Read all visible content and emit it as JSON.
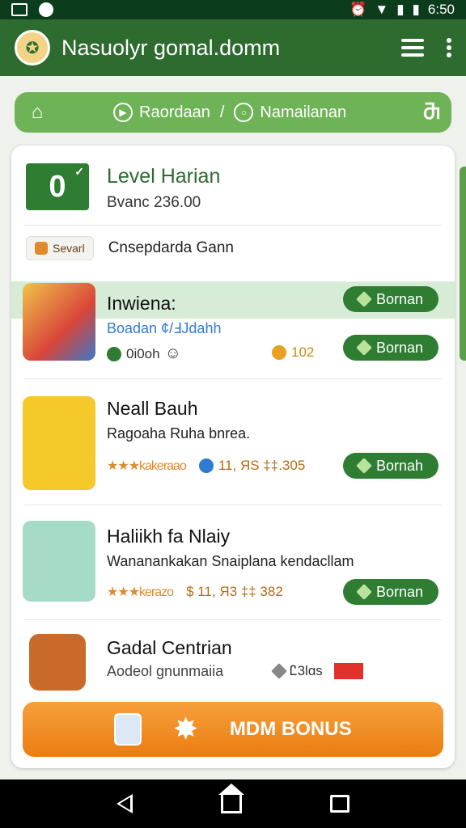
{
  "status_bar": {
    "time": "6:50"
  },
  "app_bar": {
    "title": "Nasuolyr gomal.domm"
  },
  "breadcrumb": {
    "item1": "Raordaan",
    "separator": "/",
    "item2": "Namailanan"
  },
  "level": {
    "value": "0",
    "title": "Level Harian",
    "subtitle": "Bvanc 236.00"
  },
  "tag": {
    "badge": "Sevarl",
    "label": "Cnsepdarda Gann"
  },
  "items": [
    {
      "title": "Inwiena:",
      "subtitle": "Boadan ¢/ℲJdahh",
      "meta_left": "0i0oh",
      "coins": "102",
      "button_top": "Bornan",
      "button": "Bornan"
    },
    {
      "title": "Neall Bauh",
      "subtitle": "Ragoaha  Ruha bnrea.",
      "stars_text": "★★★kakeraao",
      "price": "11, ЯS ‡‡.305",
      "button": "Bornah"
    },
    {
      "title": "Haliikh fa Nlaiy",
      "subtitle": "Wananankakan Snaiplana kendacllam",
      "stars_text": "★★★kerazo",
      "price": "$ 11, Я3 ‡‡ 382",
      "button": "Bornan"
    },
    {
      "title": "Gadal Centrian",
      "subtitle": "Aodeol gnunmaiia",
      "diamonds": "Ꮭ3lɑs"
    }
  ],
  "bonus_button": "MDM BONUS",
  "colors": {
    "primary": "#2e6b2f",
    "accent": "#ea7d12",
    "light_green": "#6fb357"
  }
}
